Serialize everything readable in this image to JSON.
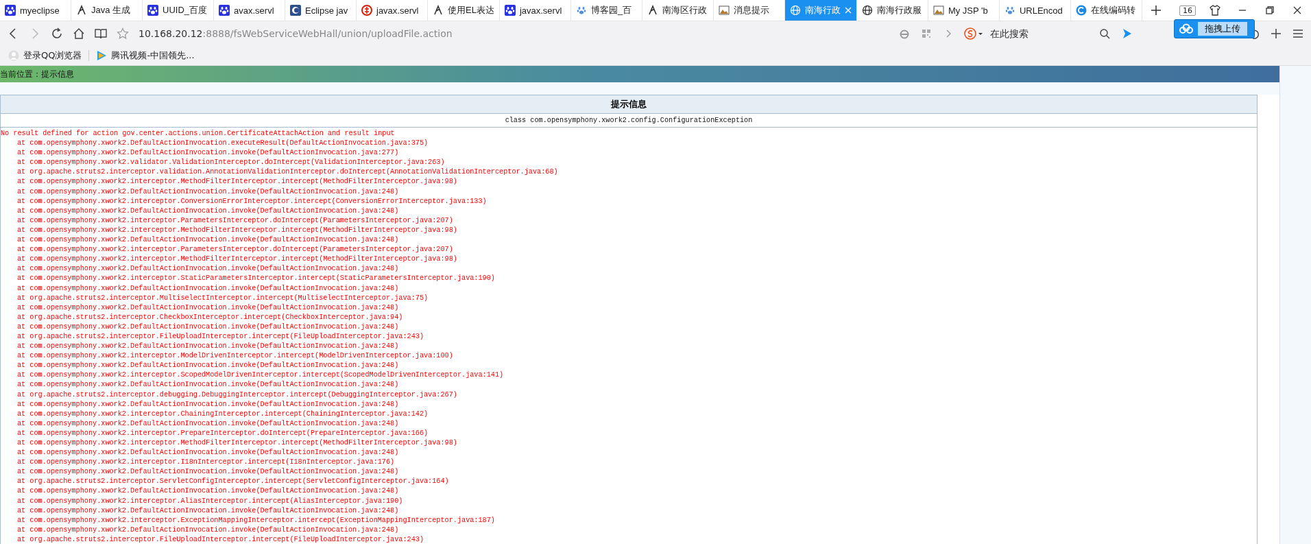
{
  "tabs": [
    {
      "title": "myeclipse",
      "selected": false
    },
    {
      "title": "Java 生成",
      "selected": false
    },
    {
      "title": "UUID_百度",
      "selected": false
    },
    {
      "title": "avax.servl",
      "selected": false
    },
    {
      "title": "Eclipse jav",
      "selected": false
    },
    {
      "title": "javax.servl",
      "selected": false
    },
    {
      "title": "使用EL表达",
      "selected": false
    },
    {
      "title": "javax.servl",
      "selected": false
    },
    {
      "title": "博客园_百",
      "selected": false
    },
    {
      "title": "南海区行政",
      "selected": false
    },
    {
      "title": "消息提示",
      "selected": false
    },
    {
      "title": "南海行政",
      "selected": true
    },
    {
      "title": "南海行政服",
      "selected": false
    },
    {
      "title": "My JSP 'b",
      "selected": false
    },
    {
      "title": "URLEncod",
      "selected": false
    },
    {
      "title": "在线编码转",
      "selected": false
    }
  ],
  "tab_count": "16",
  "address": {
    "host": "10.168.20.12",
    "path": ":8888/fsWebServiceWebHall/union/uploadFile.action"
  },
  "search": {
    "placeholder": "在此搜索"
  },
  "upload_popup": "拖拽上传",
  "bookmarks": [
    {
      "label": "登录QQ浏览器",
      "kind": "account"
    },
    {
      "label": "腾讯视频-中国领先...",
      "kind": "video"
    }
  ],
  "breadcrumb": "当前位置：提示信息",
  "panel": {
    "title": "提示信息",
    "exception_class": "class com.opensymphony.xwork2.config.ConfigurationException",
    "message": "No result defined for action gov.center.actions.union.CertificateAttachAction and result input",
    "trace": [
      "at com.opensymphony.xwork2.DefaultActionInvocation.executeResult(DefaultActionInvocation.java:375)",
      "at com.opensymphony.xwork2.DefaultActionInvocation.invoke(DefaultActionInvocation.java:277)",
      "at com.opensymphony.xwork2.validator.ValidationInterceptor.doIntercept(ValidationInterceptor.java:263)",
      "at org.apache.struts2.interceptor.validation.AnnotationValidationInterceptor.doIntercept(AnnotationValidationInterceptor.java:68)",
      "at com.opensymphony.xwork2.interceptor.MethodFilterInterceptor.intercept(MethodFilterInterceptor.java:98)",
      "at com.opensymphony.xwork2.DefaultActionInvocation.invoke(DefaultActionInvocation.java:248)",
      "at com.opensymphony.xwork2.interceptor.ConversionErrorInterceptor.intercept(ConversionErrorInterceptor.java:133)",
      "at com.opensymphony.xwork2.DefaultActionInvocation.invoke(DefaultActionInvocation.java:248)",
      "at com.opensymphony.xwork2.interceptor.ParametersInterceptor.doIntercept(ParametersInterceptor.java:207)",
      "at com.opensymphony.xwork2.interceptor.MethodFilterInterceptor.intercept(MethodFilterInterceptor.java:98)",
      "at com.opensymphony.xwork2.DefaultActionInvocation.invoke(DefaultActionInvocation.java:248)",
      "at com.opensymphony.xwork2.interceptor.ParametersInterceptor.doIntercept(ParametersInterceptor.java:207)",
      "at com.opensymphony.xwork2.interceptor.MethodFilterInterceptor.intercept(MethodFilterInterceptor.java:98)",
      "at com.opensymphony.xwork2.DefaultActionInvocation.invoke(DefaultActionInvocation.java:248)",
      "at com.opensymphony.xwork2.interceptor.StaticParametersInterceptor.intercept(StaticParametersInterceptor.java:190)",
      "at com.opensymphony.xwork2.DefaultActionInvocation.invoke(DefaultActionInvocation.java:248)",
      "at org.apache.struts2.interceptor.MultiselectInterceptor.intercept(MultiselectInterceptor.java:75)",
      "at com.opensymphony.xwork2.DefaultActionInvocation.invoke(DefaultActionInvocation.java:248)",
      "at org.apache.struts2.interceptor.CheckboxInterceptor.intercept(CheckboxInterceptor.java:94)",
      "at com.opensymphony.xwork2.DefaultActionInvocation.invoke(DefaultActionInvocation.java:248)",
      "at org.apache.struts2.interceptor.FileUploadInterceptor.intercept(FileUploadInterceptor.java:243)",
      "at com.opensymphony.xwork2.DefaultActionInvocation.invoke(DefaultActionInvocation.java:248)",
      "at com.opensymphony.xwork2.interceptor.ModelDrivenInterceptor.intercept(ModelDrivenInterceptor.java:100)",
      "at com.opensymphony.xwork2.DefaultActionInvocation.invoke(DefaultActionInvocation.java:248)",
      "at com.opensymphony.xwork2.interceptor.ScopedModelDrivenInterceptor.intercept(ScopedModelDrivenInterceptor.java:141)",
      "at com.opensymphony.xwork2.DefaultActionInvocation.invoke(DefaultActionInvocation.java:248)",
      "at org.apache.struts2.interceptor.debugging.DebuggingInterceptor.intercept(DebuggingInterceptor.java:267)",
      "at com.opensymphony.xwork2.DefaultActionInvocation.invoke(DefaultActionInvocation.java:248)",
      "at com.opensymphony.xwork2.interceptor.ChainingInterceptor.intercept(ChainingInterceptor.java:142)",
      "at com.opensymphony.xwork2.DefaultActionInvocation.invoke(DefaultActionInvocation.java:248)",
      "at com.opensymphony.xwork2.interceptor.PrepareInterceptor.doIntercept(PrepareInterceptor.java:166)",
      "at com.opensymphony.xwork2.interceptor.MethodFilterInterceptor.intercept(MethodFilterInterceptor.java:98)",
      "at com.opensymphony.xwork2.DefaultActionInvocation.invoke(DefaultActionInvocation.java:248)",
      "at com.opensymphony.xwork2.interceptor.I18nInterceptor.intercept(I18nInterceptor.java:176)",
      "at com.opensymphony.xwork2.DefaultActionInvocation.invoke(DefaultActionInvocation.java:248)",
      "at org.apache.struts2.interceptor.ServletConfigInterceptor.intercept(ServletConfigInterceptor.java:164)",
      "at com.opensymphony.xwork2.DefaultActionInvocation.invoke(DefaultActionInvocation.java:248)",
      "at com.opensymphony.xwork2.interceptor.AliasInterceptor.intercept(AliasInterceptor.java:190)",
      "at com.opensymphony.xwork2.DefaultActionInvocation.invoke(DefaultActionInvocation.java:248)",
      "at com.opensymphony.xwork2.interceptor.ExceptionMappingInterceptor.intercept(ExceptionMappingInterceptor.java:187)",
      "at com.opensymphony.xwork2.DefaultActionInvocation.invoke(DefaultActionInvocation.java:248)",
      "at org.apache.struts2.interceptor.FileUploadInterceptor.intercept(FileUploadInterceptor.java:243)"
    ]
  }
}
